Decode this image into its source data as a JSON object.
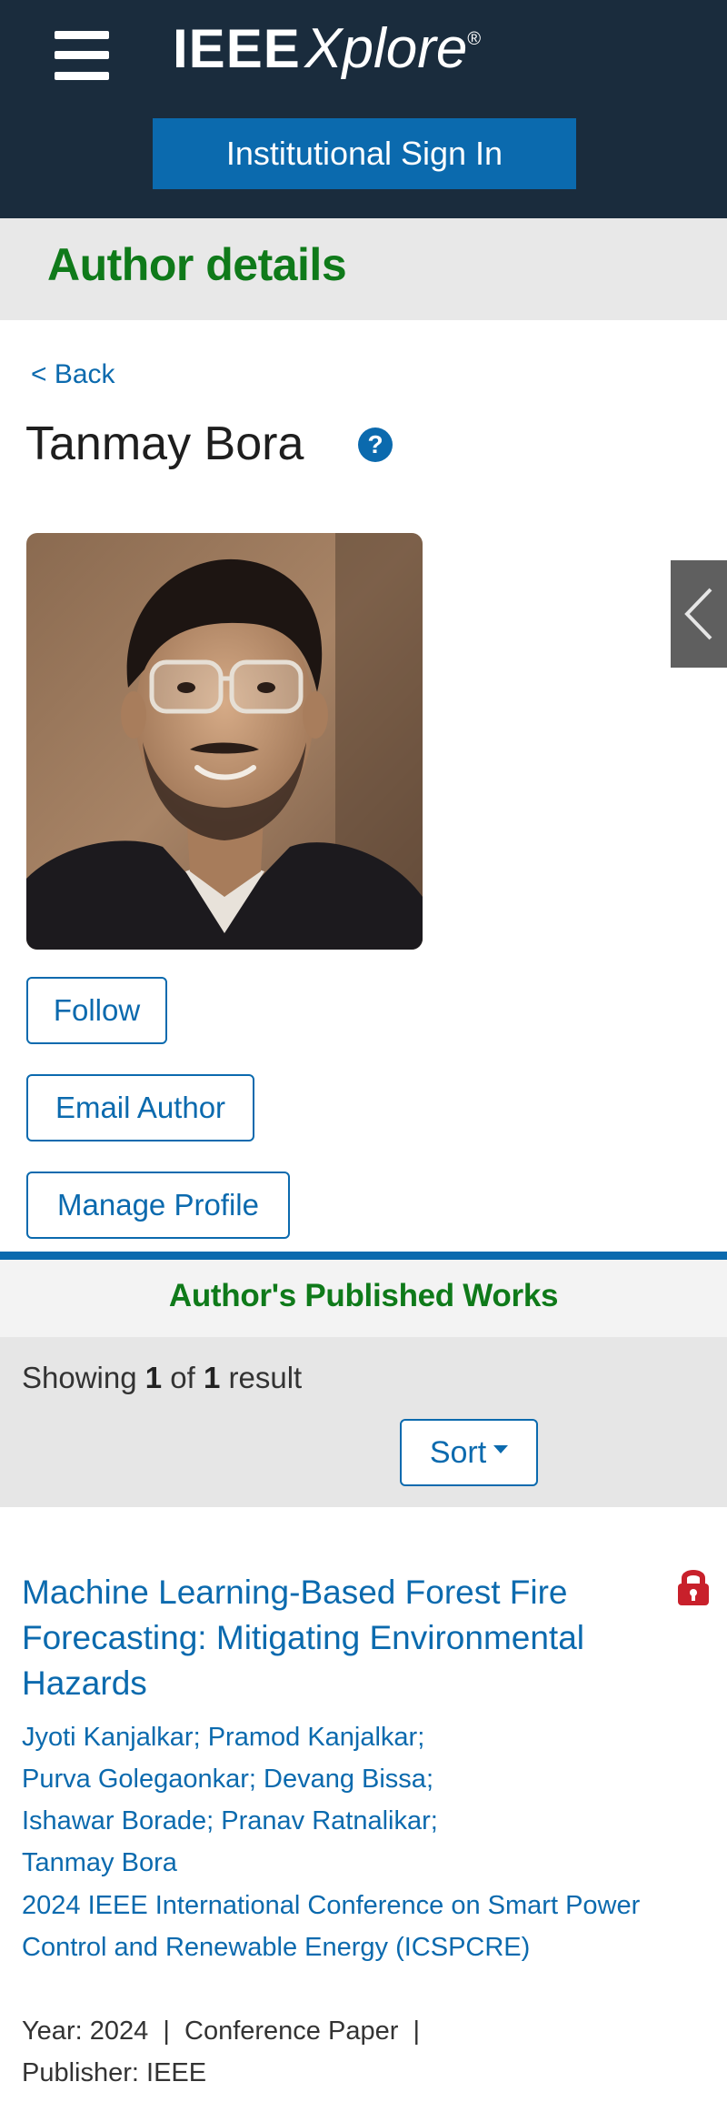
{
  "header": {
    "logo_ieee": "IEEE",
    "logo_xplore": "Xplore",
    "logo_reg": "®",
    "signin_label": "Institutional Sign In",
    "menu_icon": "hamburger-menu-icon"
  },
  "page": {
    "section_title": "Author details",
    "back_label": "< Back",
    "author_name": "Tanmay Bora",
    "help_symbol": "?"
  },
  "actions": {
    "follow_label": "Follow",
    "email_label": "Email Author",
    "manage_label": "Manage Profile"
  },
  "side_tab_icon": "chevron-left-icon",
  "publications": {
    "header": "Author's Published Works",
    "showing_prefix": "Showing",
    "showing_from": "1",
    "showing_of": "of",
    "showing_total": "1",
    "showing_suffix": "result",
    "sort_label": "Sort",
    "items": [
      {
        "title": "Machine Learning-Based Forest Fire Forecasting: Mitigating Environmental Hazards",
        "access_icon": "lock-icon",
        "authors": [
          "Jyoti Kanjalkar",
          "Pramod Kanjalkar",
          "Purva Golegaonkar",
          "Devang Bissa",
          "Ishawar Borade",
          "Pranav Ratnalikar",
          "Tanmay Bora"
        ],
        "conference": "2024 IEEE International Conference on Smart Power Control and Renewable Energy (ICSPCRE)",
        "year_label": "Year:",
        "year": "2024",
        "type": "Conference Paper",
        "publisher_label": "Publisher:",
        "publisher": "IEEE"
      }
    ]
  },
  "colors": {
    "header_bg": "#1a2c3d",
    "brand_blue": "#0b6aae",
    "title_green": "#0f7a1a",
    "lock_red": "#c8202b"
  }
}
